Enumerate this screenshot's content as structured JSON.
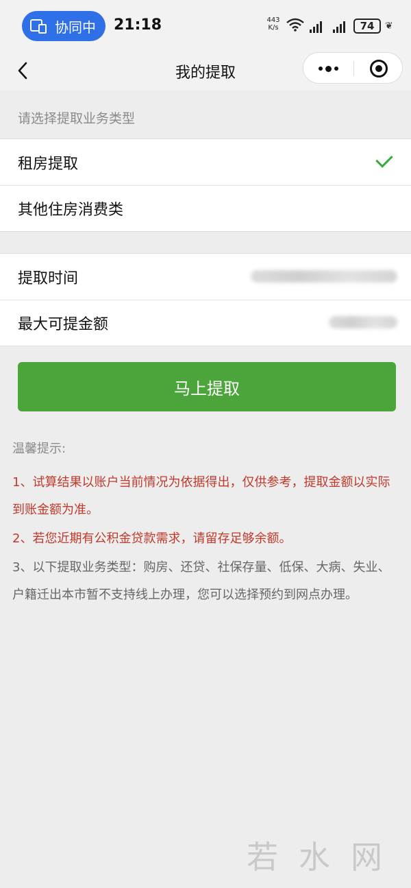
{
  "status_bar": {
    "collab_label": "协同中",
    "time": "21:18",
    "net_speed_value": "443",
    "net_speed_unit": "K/s",
    "battery": "74"
  },
  "nav": {
    "title": "我的提取"
  },
  "type_section": {
    "header": "请选择提取业务类型",
    "options": [
      {
        "label": "租房提取",
        "selected": true
      },
      {
        "label": "其他住房消费类",
        "selected": false
      }
    ]
  },
  "info_section": {
    "rows": [
      {
        "label": "提取时间"
      },
      {
        "label": "最大可提金额"
      }
    ]
  },
  "submit_label": "马上提取",
  "tips": {
    "title": "温馨提示:",
    "items": [
      "1、试算结果以账户当前情况为依据得出，仅供参考，提取金额以实际到账金额为准。",
      "2、若您近期有公积金贷款需求，请留存足够余额。",
      "3、以下提取业务类型：购房、还贷、社保存量、低保、大病、失业、户籍迁出本市暂不支持线上办理，您可以选择预约到网点办理。"
    ]
  },
  "watermark": "若水网",
  "colors": {
    "accent_green": "#4ba53a",
    "warning_red": "#c0392b",
    "collab_blue": "#2f6fe8"
  }
}
